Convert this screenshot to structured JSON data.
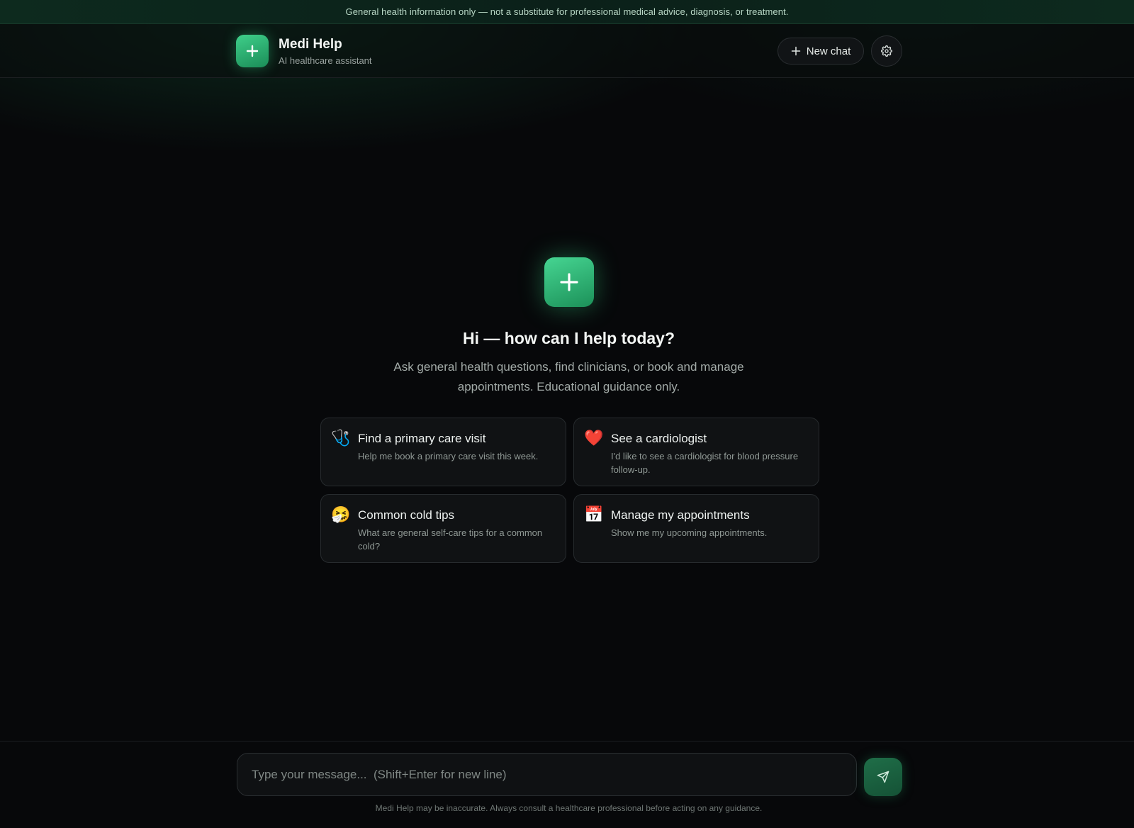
{
  "banner": {
    "text": "General health information only — not a substitute for professional medical advice, diagnosis, or treatment."
  },
  "header": {
    "title": "Medi Help",
    "subtitle": "AI healthcare assistant",
    "new_chat_label": "New chat",
    "icons": {
      "logo": "plus-icon",
      "new_chat": "plus-icon",
      "settings": "gear-icon"
    }
  },
  "hero": {
    "title": "Hi — how can I help today?",
    "subtitle": "Ask general health questions, find clinicians, or book and manage appointments. Educational guidance only."
  },
  "suggestions": [
    {
      "icon": "stethoscope-icon",
      "glyph": "🩺",
      "title": "Find a primary care visit",
      "description": "Help me book a primary care visit this week."
    },
    {
      "icon": "heart-icon",
      "glyph": "❤️",
      "title": "See a cardiologist",
      "description": "I'd like to see a cardiologist for blood pressure follow-up."
    },
    {
      "icon": "sneezing-face-icon",
      "glyph": "🤧",
      "title": "Common cold tips",
      "description": "What are general self-care tips for a common cold?"
    },
    {
      "icon": "calendar-icon",
      "glyph": "📅",
      "title": "Manage my appointments",
      "description": "Show me my upcoming appointments."
    }
  ],
  "composer": {
    "placeholder": "Type your message...  (Shift+Enter for new line)",
    "value": "",
    "send_icon": "send-icon"
  },
  "footer": {
    "disclaimer": "Medi Help may be inaccurate. Always consult a healthcare professional before acting on any guidance."
  },
  "colors": {
    "accent": "#2fb374",
    "background": "#07080a",
    "banner_bg": "#0d2a1e"
  }
}
